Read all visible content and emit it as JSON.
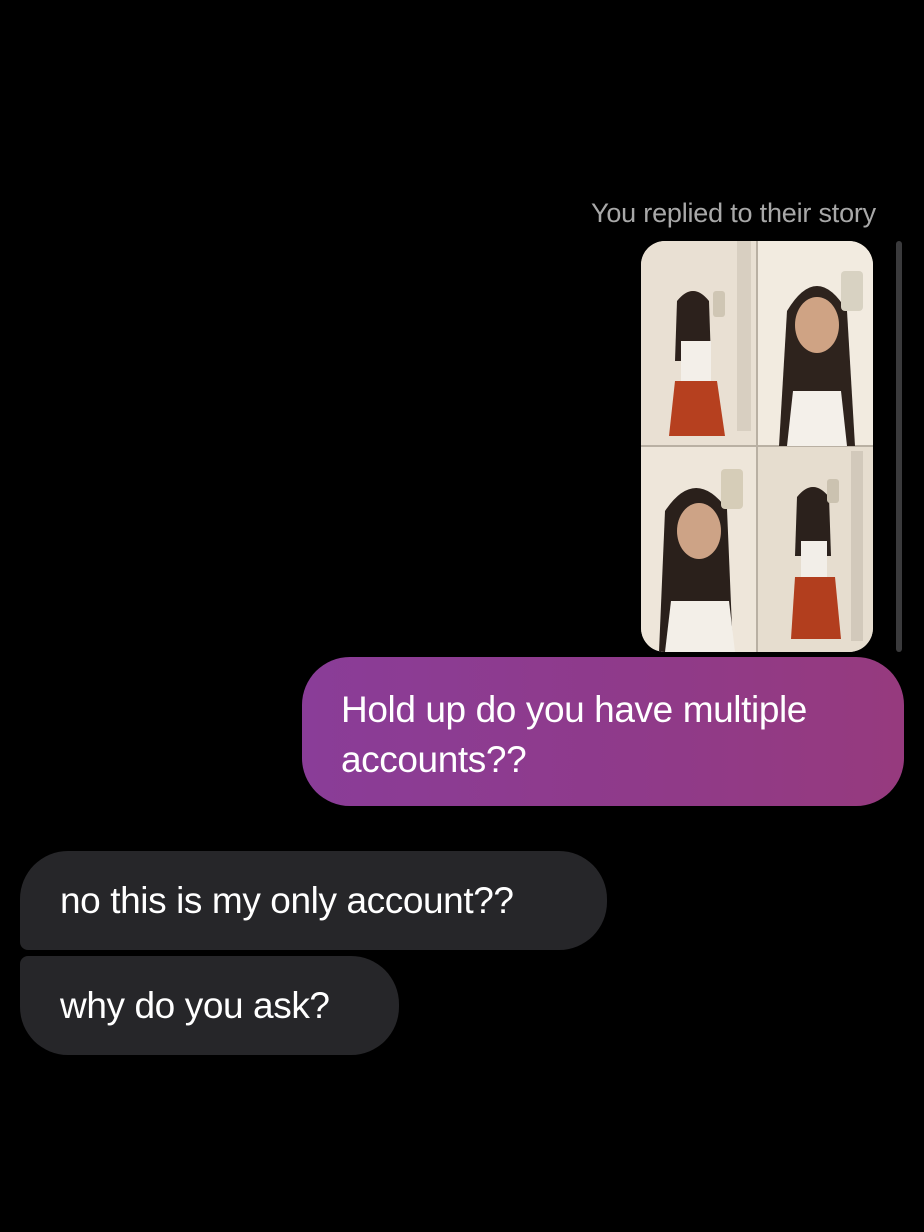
{
  "story_reply": {
    "caption": "You replied to their story",
    "thumbnail": {
      "description_icon": "story-collage-image",
      "panels": 4
    }
  },
  "messages": [
    {
      "sender": "me",
      "text": "Hold up do you have multiple accounts??"
    },
    {
      "sender": "them",
      "text": "no this is my only account??"
    },
    {
      "sender": "them",
      "text": "why do you ask?"
    }
  ],
  "colors": {
    "background": "#000000",
    "outgoing_bubble": "#8f3a8a",
    "incoming_bubble": "#262629",
    "caption_text": "#a8a8a8"
  }
}
